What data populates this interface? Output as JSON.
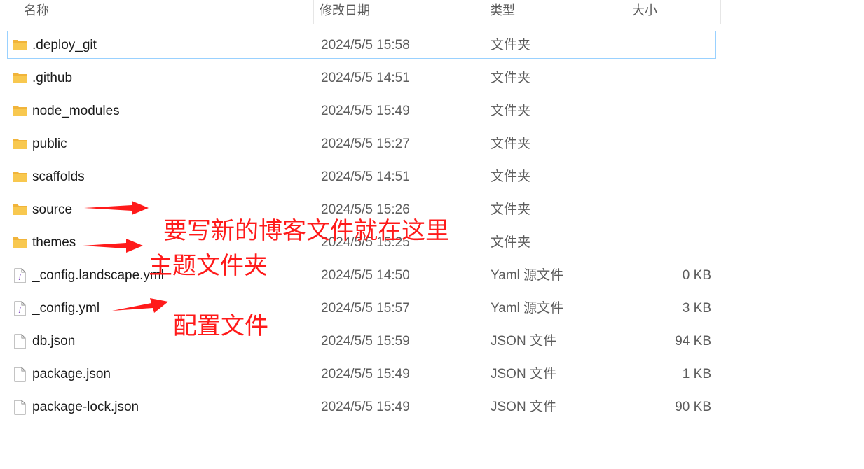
{
  "columns": {
    "name": "名称",
    "date": "修改日期",
    "type": "类型",
    "size": "大小"
  },
  "files": [
    {
      "name": ".deploy_git",
      "date": "2024/5/5 15:58",
      "type": "文件夹",
      "size": "",
      "icon": "folder-icon",
      "selected": true
    },
    {
      "name": ".github",
      "date": "2024/5/5 14:51",
      "type": "文件夹",
      "size": "",
      "icon": "folder-icon"
    },
    {
      "name": "node_modules",
      "date": "2024/5/5 15:49",
      "type": "文件夹",
      "size": "",
      "icon": "folder-icon"
    },
    {
      "name": "public",
      "date": "2024/5/5 15:27",
      "type": "文件夹",
      "size": "",
      "icon": "folder-icon"
    },
    {
      "name": "scaffolds",
      "date": "2024/5/5 14:51",
      "type": "文件夹",
      "size": "",
      "icon": "folder-icon"
    },
    {
      "name": "source",
      "date": "2024/5/5 15:26",
      "type": "文件夹",
      "size": "",
      "icon": "folder-icon"
    },
    {
      "name": "themes",
      "date": "2024/5/5 15:25",
      "type": "文件夹",
      "size": "",
      "icon": "folder-icon"
    },
    {
      "name": "_config.landscape.yml",
      "date": "2024/5/5 14:50",
      "type": "Yaml 源文件",
      "size": "0 KB",
      "icon": "yaml-file-icon"
    },
    {
      "name": "_config.yml",
      "date": "2024/5/5 15:57",
      "type": "Yaml 源文件",
      "size": "3 KB",
      "icon": "yaml-file-icon"
    },
    {
      "name": "db.json",
      "date": "2024/5/5 15:59",
      "type": "JSON 文件",
      "size": "94 KB",
      "icon": "file-icon"
    },
    {
      "name": "package.json",
      "date": "2024/5/5 15:49",
      "type": "JSON 文件",
      "size": "1 KB",
      "icon": "file-icon"
    },
    {
      "name": "package-lock.json",
      "date": "2024/5/5 15:49",
      "type": "JSON 文件",
      "size": "90 KB",
      "icon": "file-icon"
    }
  ],
  "annotations": {
    "source_note": "要写新的博客文件就在这里",
    "themes_note": "主题文件夹",
    "config_note": "配置文件",
    "color": "#ff1a1a"
  },
  "colors": {
    "folder": "#f8c44f",
    "selection_border": "#99d1ff"
  }
}
